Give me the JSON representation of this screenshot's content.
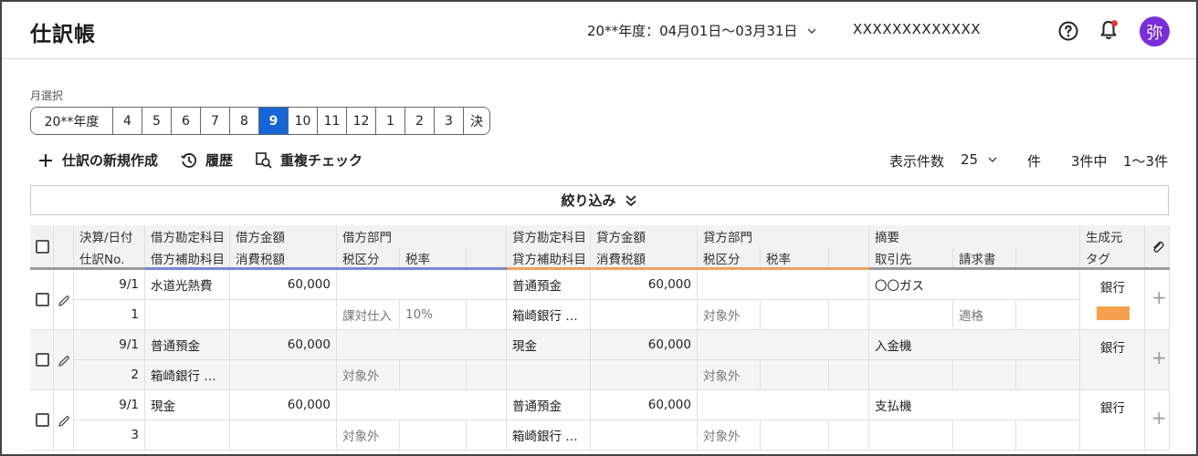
{
  "header": {
    "title": "仕訳帳",
    "period": "20**年度：04月01日〜03月31日",
    "company": "XXXXXXXXXXXXX",
    "avatar_char": "弥"
  },
  "month_selector": {
    "label": "月選択",
    "months": [
      "20**年度",
      "4",
      "5",
      "6",
      "7",
      "8",
      "9",
      "10",
      "11",
      "12",
      "1",
      "2",
      "3",
      "決"
    ],
    "active": "9"
  },
  "toolbar": {
    "new_label": "仕訳の新規作成",
    "history_label": "履歴",
    "duplicate_label": "重複チェック",
    "per_page_label": "表示件数",
    "per_page_value": "25",
    "per_page_unit": "件",
    "total_label": "3件中",
    "range_label": "1〜3件"
  },
  "filter": {
    "label": "絞り込み"
  },
  "table": {
    "headers": {
      "date": "決算/日付",
      "no": "仕訳No.",
      "debit_account": "借方勘定科目",
      "debit_sub": "借方補助科目",
      "debit_amount": "借方金額",
      "debit_tax_amount": "消費税額",
      "debit_dept": "借方部門",
      "debit_tax_class": "税区分",
      "debit_tax_rate": "税率",
      "credit_account": "貸方勘定科目",
      "credit_sub": "貸方補助科目",
      "credit_amount": "貸方金額",
      "credit_tax_amount": "消費税額",
      "credit_dept": "貸方部門",
      "credit_tax_class": "税区分",
      "credit_tax_rate": "税率",
      "memo": "摘要",
      "partner": "取引先",
      "invoice": "請求書",
      "source": "生成元",
      "tag": "タグ"
    },
    "rows": [
      {
        "date": "9/1",
        "no": "1",
        "debit_account": "水道光熱費",
        "debit_sub": "",
        "debit_amount": "60,000",
        "debit_tax_class": "課対仕入",
        "debit_tax_rate": "10%",
        "credit_account": "普通預金",
        "credit_sub": "箱崎銀行 …",
        "credit_amount": "60,000",
        "credit_tax_class": "対象外",
        "credit_tax_rate": "",
        "memo": "〇〇ガス",
        "partner": "",
        "invoice": "適格",
        "source": "銀行",
        "tag_color": "#f6a04d"
      },
      {
        "date": "9/1",
        "no": "2",
        "debit_account": "普通預金",
        "debit_sub": "箱崎銀行 …",
        "debit_amount": "60,000",
        "debit_tax_class": "対象外",
        "debit_tax_rate": "",
        "credit_account": "現金",
        "credit_sub": "",
        "credit_amount": "60,000",
        "credit_tax_class": "対象外",
        "credit_tax_rate": "",
        "memo": "入金機",
        "partner": "",
        "invoice": "",
        "source": "銀行",
        "tag_color": ""
      },
      {
        "date": "9/1",
        "no": "3",
        "debit_account": "現金",
        "debit_sub": "",
        "debit_amount": "60,000",
        "debit_tax_class": "対象外",
        "debit_tax_rate": "",
        "credit_account": "普通預金",
        "credit_sub": "箱崎銀行 …",
        "credit_amount": "60,000",
        "credit_tax_class": "対象外",
        "credit_tax_rate": "",
        "memo": "支払機",
        "partner": "",
        "invoice": "",
        "source": "銀行",
        "tag_color": ""
      }
    ]
  },
  "colors": {
    "accent": "#1565d8",
    "debit_underline": "#7b86d8",
    "credit_underline": "#f0a060",
    "avatar": "#7a2ed8",
    "notification_dot": "#e53935"
  }
}
